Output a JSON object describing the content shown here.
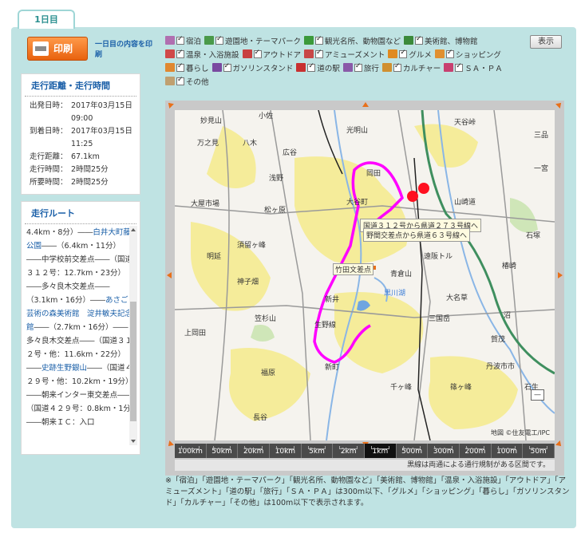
{
  "tab": {
    "label": "1日目"
  },
  "print": {
    "label": "印刷",
    "note": "一日目の内容を印刷"
  },
  "distance_box": {
    "title": "走行距離・走行時間",
    "rows": [
      {
        "key": "出発日時：",
        "value": "2017年03月15日"
      },
      {
        "key": "",
        "value": "09:00"
      },
      {
        "key": "到着日時：",
        "value": "2017年03月15日"
      },
      {
        "key": "",
        "value": "11:25"
      },
      {
        "key": "走行距離：",
        "value": "67.1km"
      },
      {
        "key": "走行時間：",
        "value": "2時間25分"
      },
      {
        "key": "所要時間：",
        "value": "2時間25分"
      }
    ]
  },
  "route_box": {
    "title": "走行ルート",
    "segments": [
      {
        "text": "4.4km・8分）――",
        "link": false
      },
      {
        "text": "白井大町藤公園",
        "link": true
      },
      {
        "text": "――（6.4km・11分）――中学校前交差点――（国道３１２号：12.7km・23分）――多々良木交差点――（3.1km・16分）――",
        "link": false
      },
      {
        "text": "あさご芸術の森美術館　淀井敏夫記念館",
        "link": true
      },
      {
        "text": "――（2.7km・16分）――多々良木交差点――（国道３１２号・他：11.6km・22分）――",
        "link": false
      },
      {
        "text": "史跡生野銀山",
        "link": true
      },
      {
        "text": "――（国道４２９号・他：10.2km・19分）――朝来インター東交差点――（国道４２９号：0.8km・1分）――朝来ＩＣ：入口",
        "link": false
      }
    ]
  },
  "filters": {
    "rows": [
      [
        {
          "label": "宿泊",
          "icon": "hotel-icon",
          "color": "#b06fb0"
        },
        {
          "label": "遊園地・テーマパーク",
          "icon": "park-icon",
          "color": "#4a9a4a"
        },
        {
          "label": "観光名所、動物園など",
          "icon": "sightseeing-icon",
          "color": "#3b9a3b"
        },
        {
          "label": "美術館、博物館",
          "icon": "museum-icon",
          "color": "#3b8a3b"
        }
      ],
      [
        {
          "label": "温泉・入浴施設",
          "icon": "onsen-icon",
          "color": "#d04848"
        },
        {
          "label": "アウトドア",
          "icon": "outdoor-icon",
          "color": "#c84040"
        },
        {
          "label": "アミューズメント",
          "icon": "amusement-icon",
          "color": "#c84848"
        },
        {
          "label": "グルメ",
          "icon": "gourmet-icon",
          "color": "#e08a20"
        },
        {
          "label": "ショッピング",
          "icon": "shopping-icon",
          "color": "#e09030"
        }
      ],
      [
        {
          "label": "暮らし",
          "icon": "living-icon",
          "color": "#e08830"
        },
        {
          "label": "ガソリンスタンド",
          "icon": "gas-station-icon",
          "color": "#7a4aa0"
        },
        {
          "label": "道の駅",
          "icon": "roadside-station-icon",
          "color": "#c83030"
        },
        {
          "label": "旅行",
          "icon": "travel-icon",
          "color": "#8a5aa8"
        },
        {
          "label": "カルチャー",
          "icon": "culture-icon",
          "color": "#d09030"
        },
        {
          "label": "ＳＡ・ＰＡ",
          "icon": "sa-pa-icon",
          "color": "#c84070"
        }
      ],
      [
        {
          "label": "その他",
          "icon": "other-icon",
          "color": "#c0a070"
        }
      ]
    ],
    "show_button": "表示"
  },
  "map": {
    "labels": [
      {
        "text": "妙見山"
      },
      {
        "text": "小佐"
      },
      {
        "text": "天谷峠"
      },
      {
        "text": "万之見"
      },
      {
        "text": "八木"
      },
      {
        "text": "光明山"
      },
      {
        "text": "三品"
      },
      {
        "text": "広谷"
      },
      {
        "text": "浅野"
      },
      {
        "text": "岡田"
      },
      {
        "text": "一宮"
      },
      {
        "text": "大屋市場"
      },
      {
        "text": "大谷町"
      },
      {
        "text": "山崎道"
      },
      {
        "text": "松ヶ原"
      },
      {
        "text": "石塚"
      },
      {
        "text": "須留ヶ峰"
      },
      {
        "text": "明延"
      },
      {
        "text": "遠阪トル"
      },
      {
        "text": "椿崎"
      },
      {
        "text": "神子畑"
      },
      {
        "text": "竹田文差点"
      },
      {
        "text": "青倉山"
      },
      {
        "text": "黒川湖"
      },
      {
        "text": "新井"
      },
      {
        "text": "大名草"
      },
      {
        "text": "笠杉山"
      },
      {
        "text": "三国岳"
      },
      {
        "text": "沼"
      },
      {
        "text": "上岡田"
      },
      {
        "text": "生野線"
      },
      {
        "text": "賀茂"
      },
      {
        "text": "福原"
      },
      {
        "text": "新町"
      },
      {
        "text": "丹波市市"
      },
      {
        "text": "千ヶ峰"
      },
      {
        "text": "篠ヶ峰"
      },
      {
        "text": "石生"
      },
      {
        "text": "長谷"
      }
    ],
    "callouts": [
      {
        "text": "国道３１２号から県道２７３号線へ"
      },
      {
        "text": "野間交差点から県道６３号線へ"
      }
    ],
    "copyright": "地図 ©住友電工/IPC",
    "scales": [
      "100km",
      "50km",
      "20km",
      "10km",
      "5km",
      "2km",
      "1km",
      "500m",
      "300m",
      "200m",
      "100m",
      "50m"
    ],
    "active_scale": "1km",
    "note": "黒線は両通による通行規制がある区間です。"
  },
  "footnote": "※「宿泊」「遊園地・テーマパーク」「観光名所、動物園など」「美術館、博物館」「温泉・入浴施設」「アウトドア」「アミューズメント」「道の駅」「旅行」「ＳＡ・ＰＡ」は300m以下、「グルメ」「ショッピング」「暮らし」「ガソリンスタンド」「カルチャー」「その他」は100m以下で表示されます。"
}
